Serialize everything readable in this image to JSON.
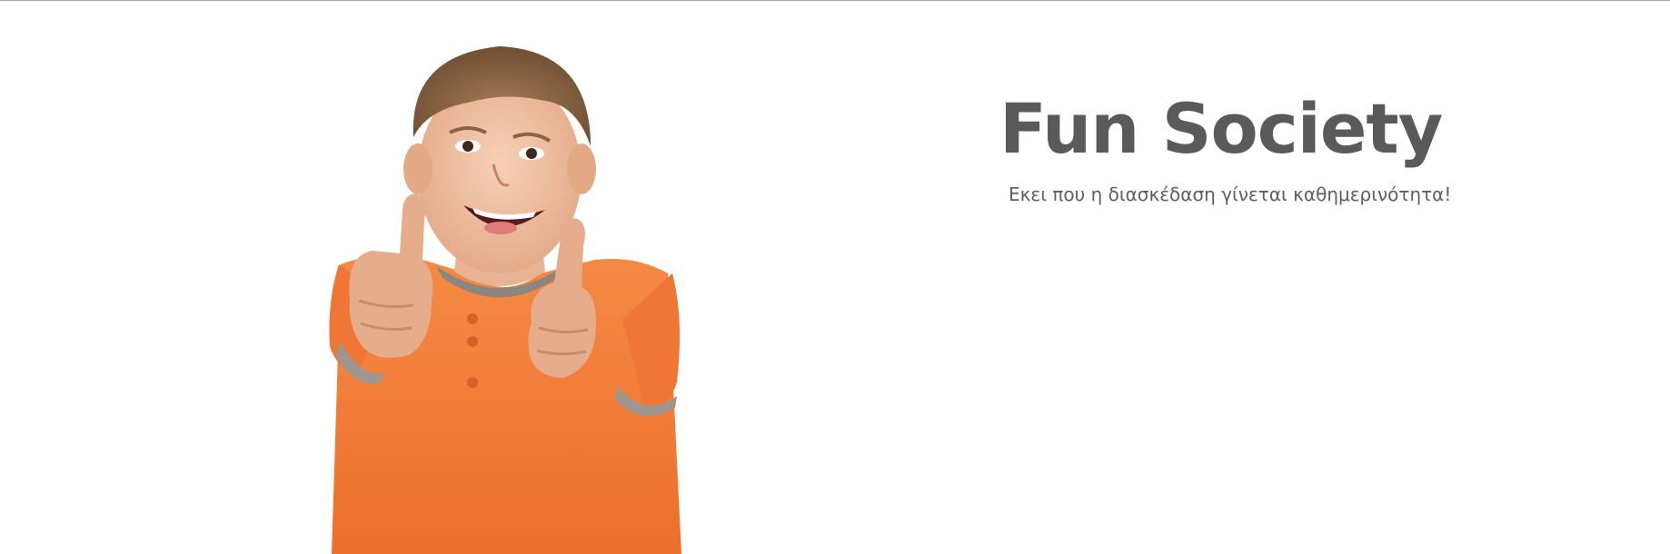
{
  "hero": {
    "title": "Fun Society",
    "tagline": "Εκει που η διασκέδαση γίνεται καθημερινότητα!",
    "image_subject": "child-thumbs-up",
    "colors": {
      "title": "#5a5a5a",
      "tagline": "#5f5f5f",
      "shirt": "#f07a36",
      "background": "#ffffff"
    }
  }
}
